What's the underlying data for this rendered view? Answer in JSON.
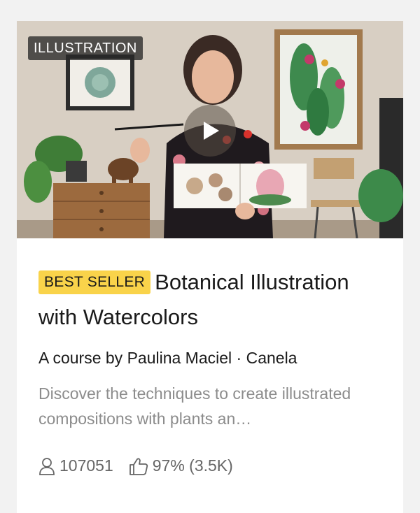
{
  "course": {
    "category": "ILLUSTRATION",
    "badge": "BEST SELLER",
    "title": "Botanical Illustration with Watercolors",
    "author_line": "A course by Paulina Maciel · Canela",
    "description": "Discover the techniques to create illustrated compositions with plants an…",
    "students": "107051",
    "rating": "97% (3.5K)"
  },
  "icons": {
    "play": "play-icon",
    "students": "user-icon",
    "rating": "thumbs-up-icon"
  },
  "colors": {
    "badge_yellow": "#f9d34a",
    "category_bg": "#282828",
    "muted_text": "#8c8c8c"
  }
}
